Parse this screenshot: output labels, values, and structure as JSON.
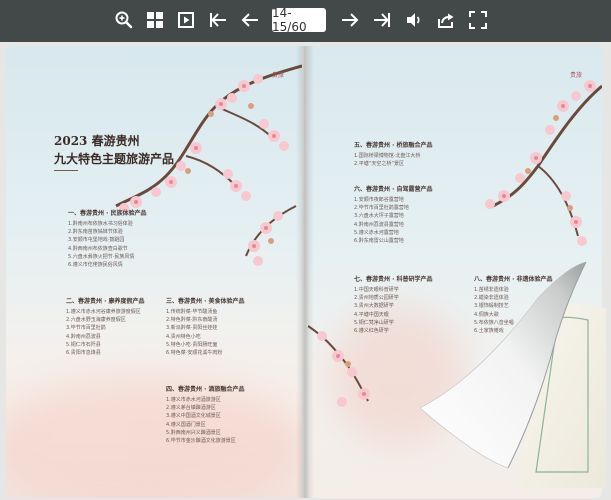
{
  "toolbar": {
    "page_indicator": "14-15/60",
    "buttons": [
      "zoom-in",
      "thumbnails",
      "auto-play",
      "first-page",
      "previous-page",
      "next-page",
      "last-page",
      "sound",
      "share",
      "fullscreen"
    ]
  },
  "left_page": {
    "logo": "贵旅",
    "heading_line1": "2023 春游贵州",
    "heading_line2": "九大特色主题旅游产品",
    "sections": [
      {
        "title": "一、春游贵州 · 民族体验产品",
        "items": [
          "1.黔南州布依族水书习俗体验",
          "2.黔东南苗族姊妹节体验",
          "3.安顺市屯堡地戏·鼓蹈园",
          "4.黔西南州布依族查白歌节",
          "5.六盘水彝族火把节·民族风情",
          "6.遵义市仡佬族民俗风情"
        ]
      },
      {
        "title": "二、春游贵州 · 康养度假产品",
        "items": [
          "1.遵义市赤水河谷康养旅游度假区",
          "2.六盘水野玉海康养度假区",
          "3.毕节市百里杜鹃",
          "4.黔南州荔波县",
          "5.铜仁市石阡县",
          "6.贵阳市息烽县"
        ]
      },
      {
        "title": "三、春游贵州 · 美食体验产品",
        "items": [
          "1.传统黔菜·毕节酸汤鱼",
          "2.特色黔菜·黔东南酸汤",
          "3.新派黔菜·贵阳丝娃娃",
          "4.贵州特色小吃",
          "5.特色小吃·贵阳肠旺面",
          "6.特色菜·安顺花溪牛肉粉"
        ]
      },
      {
        "title": "四、春游贵州 · 酒旅融合产品",
        "items": [
          "1.遵义市赤水河酒旅游区",
          "2.遵义茅台镇酿酒游区",
          "3.遵义中国酒文化城景区",
          "4.遵义国酒门景区",
          "5.黔西南州兴义酿酒景区",
          "6.毕节市金沙酿酒文化旅游景区"
        ]
      }
    ]
  },
  "right_page": {
    "logo": "贵旅",
    "sections": [
      {
        "title": "五、春游贵州 · 桥旅融合产品",
        "items": [
          "1.国际桥梁博物馆·北盘江大桥",
          "2.平塘“天空之桥”景区"
        ]
      },
      {
        "title": "六、春游贵州 · 自驾露营产品",
        "items": [
          "1.安顺市夜郎谷露营地",
          "2.毕节市百里杜鹃露营地",
          "3.六盘水大坪子露营地",
          "4.黔南州荔波县露营地",
          "5.遵义赤水河露营地",
          "6.黔东南雷公山露营地"
        ]
      },
      {
        "title": "七、春游贵州 · 科普研学产品",
        "items": [
          "1.中国天眼科普研学",
          "2.贵州地质公园研学",
          "3.贵州大数据研学",
          "4.平塘中国天眼",
          "5.铜仁梵净山研学",
          "6.遵义红色研学"
        ]
      },
      {
        "title": "八、春游贵州 · 非遗体验产品",
        "items": [
          "1.苗绣非遗体验",
          "2.蜡染非遗体验",
          "3.银饰锻制技艺",
          "4.侗族大歌",
          "5.布依族八音坐唱",
          "6.土家族傩戏"
        ]
      }
    ]
  }
}
